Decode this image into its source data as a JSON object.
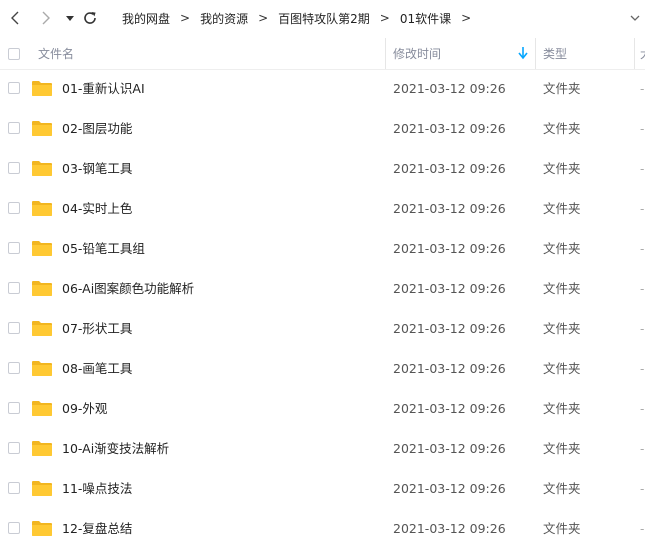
{
  "nav": {
    "breadcrumb": [
      "我的网盘",
      "我的资源",
      "百图特攻队第2期",
      "01软件课"
    ],
    "separator": ">"
  },
  "table": {
    "columns": {
      "name": "文件名",
      "modified": "修改时间",
      "type": "类型",
      "size": "大"
    },
    "sort_indicator": "arrow-down-icon",
    "rows": [
      {
        "name": "01-重新认识AI",
        "modified": "2021-03-12 09:26",
        "type": "文件夹",
        "size": "-"
      },
      {
        "name": "02-图层功能",
        "modified": "2021-03-12 09:26",
        "type": "文件夹",
        "size": "-"
      },
      {
        "name": "03-钢笔工具",
        "modified": "2021-03-12 09:26",
        "type": "文件夹",
        "size": "-"
      },
      {
        "name": "04-实时上色",
        "modified": "2021-03-12 09:26",
        "type": "文件夹",
        "size": "-"
      },
      {
        "name": "05-铅笔工具组",
        "modified": "2021-03-12 09:26",
        "type": "文件夹",
        "size": "-"
      },
      {
        "name": "06-Ai图案颜色功能解析",
        "modified": "2021-03-12 09:26",
        "type": "文件夹",
        "size": "-"
      },
      {
        "name": "07-形状工具",
        "modified": "2021-03-12 09:26",
        "type": "文件夹",
        "size": "-"
      },
      {
        "name": "08-画笔工具",
        "modified": "2021-03-12 09:26",
        "type": "文件夹",
        "size": "-"
      },
      {
        "name": "09-外观",
        "modified": "2021-03-12 09:26",
        "type": "文件夹",
        "size": "-"
      },
      {
        "name": "10-Ai渐变技法解析",
        "modified": "2021-03-12 09:26",
        "type": "文件夹",
        "size": "-"
      },
      {
        "name": "11-噪点技法",
        "modified": "2021-03-12 09:26",
        "type": "文件夹",
        "size": "-"
      },
      {
        "name": "12-复盘总结",
        "modified": "2021-03-12 09:26",
        "type": "文件夹",
        "size": "-"
      }
    ]
  },
  "colors": {
    "folder": "#ffc933",
    "folder_tab": "#f2b620",
    "accent": "#06a7ff",
    "header_text": "#878c9c"
  }
}
